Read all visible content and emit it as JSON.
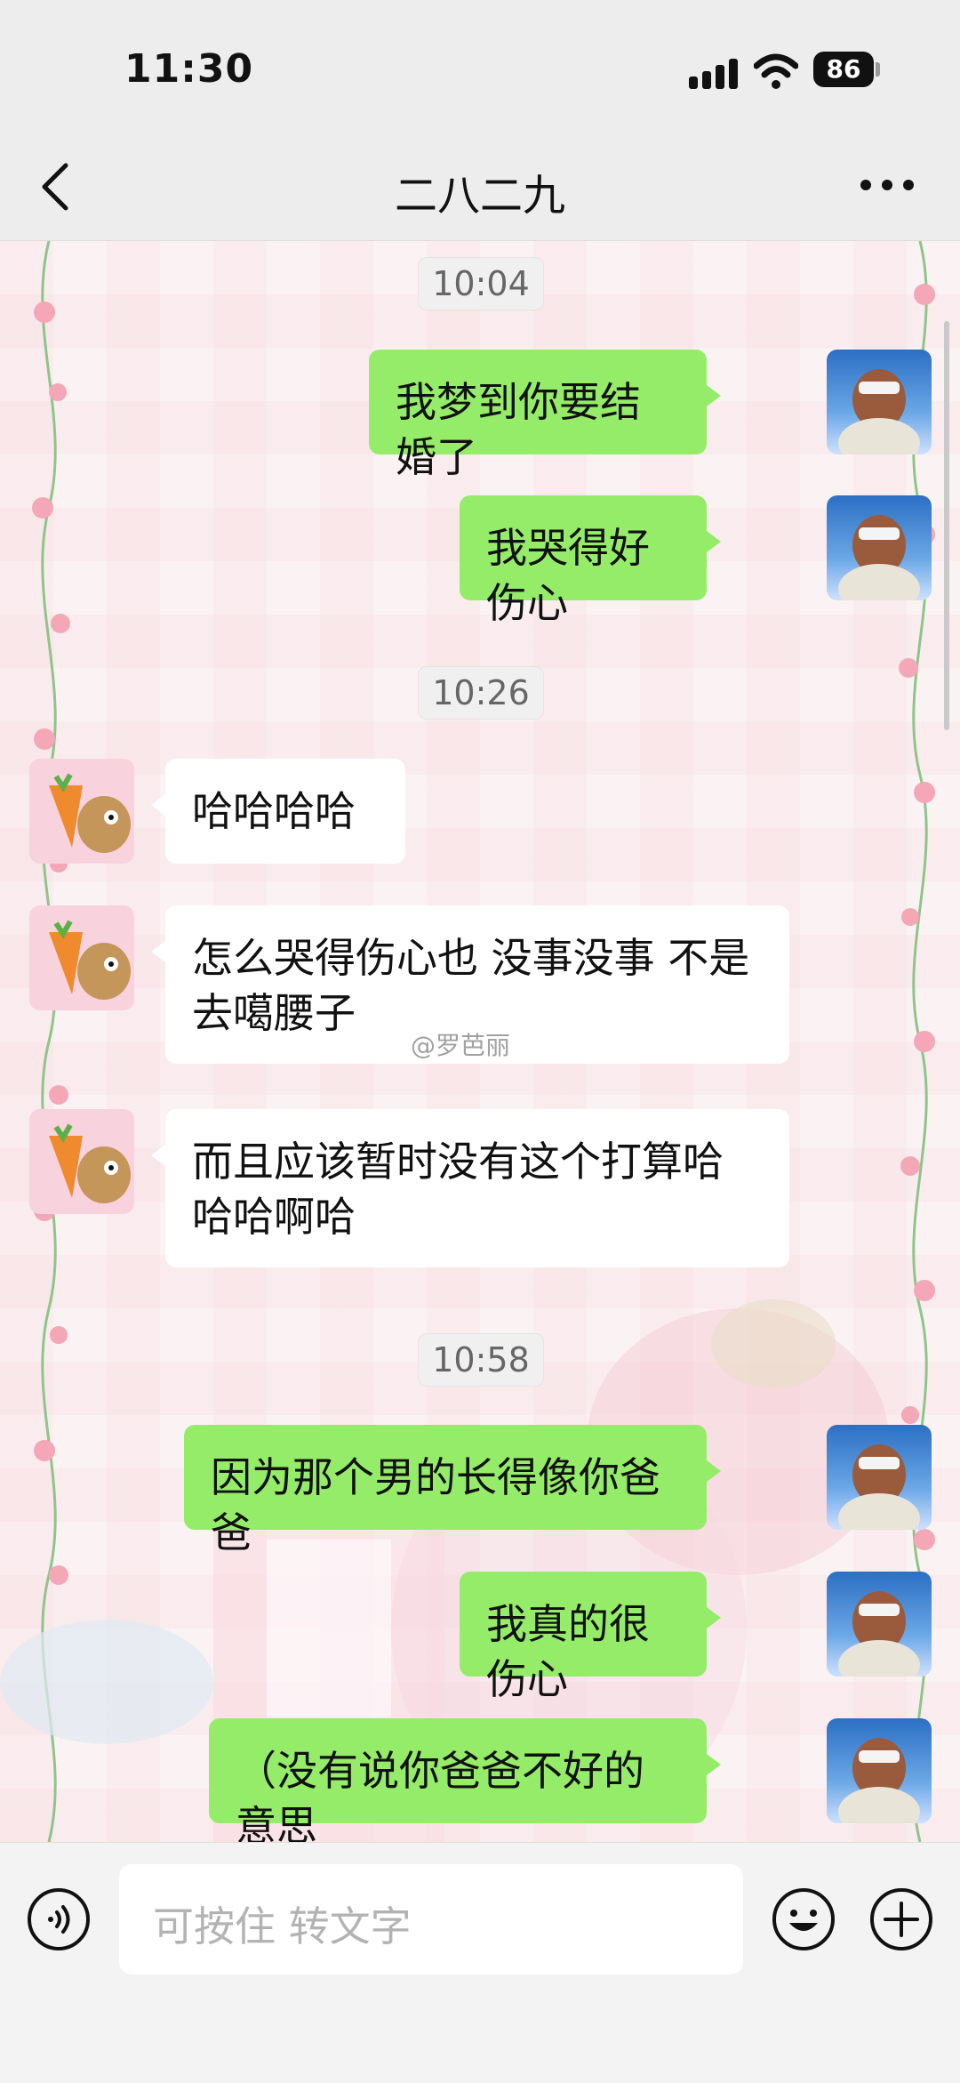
{
  "status": {
    "time": "11:30",
    "battery": "86"
  },
  "header": {
    "title": "二八二九"
  },
  "timestamps": [
    "10:04",
    "10:26",
    "10:58"
  ],
  "messages": [
    {
      "from": "me",
      "text": "我梦到你要结婚了"
    },
    {
      "from": "me",
      "text": "我哭得好伤心"
    },
    {
      "from": "other",
      "text": "哈哈哈哈"
    },
    {
      "from": "other",
      "text": "怎么哭得伤心也 没事没事 不是去噶腰子"
    },
    {
      "from": "other",
      "text": "而且应该暂时没有这个打算哈哈哈啊哈"
    },
    {
      "from": "me",
      "text": "因为那个男的长得像你爸爸"
    },
    {
      "from": "me",
      "text": "我真的很伤心"
    },
    {
      "from": "me",
      "text": "（没有说你爸爸不好的意思"
    }
  ],
  "watermark": "@罗芭丽",
  "input": {
    "placeholder": "可按住 转文字"
  },
  "icons": {
    "back": "chevron-left-icon",
    "more": "more-dots-icon",
    "voice": "voice-icon",
    "emoji": "emoji-icon",
    "plus": "plus-icon"
  },
  "colors": {
    "my_bubble": "#95ec69",
    "other_bubble": "#ffffff",
    "bar_bg": "#ededed"
  }
}
